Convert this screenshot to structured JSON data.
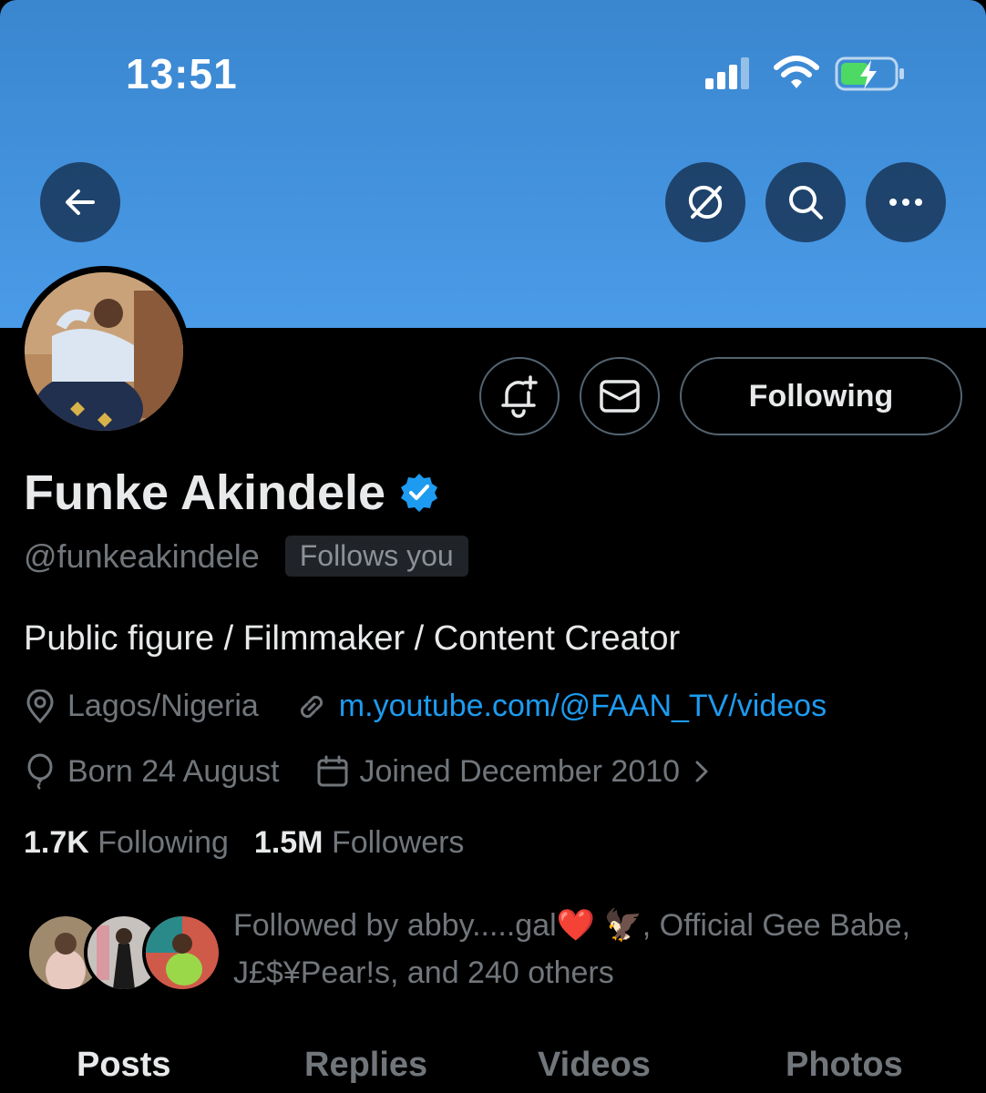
{
  "status_bar": {
    "time": "13:51"
  },
  "profile": {
    "display_name": "Funke Akindele",
    "handle": "@funkeakindele",
    "follows_you": "Follows you",
    "bio": "Public figure / Filmmaker / Content Creator",
    "location": "Lagos/Nigeria",
    "website": "m.youtube.com/@FAAN_TV/videos",
    "birthday": "Born 24 August",
    "joined": "Joined December 2010",
    "following_count": "1.7K",
    "following_label": "Following",
    "followers_count": "1.5M",
    "followers_label": "Followers"
  },
  "actions": {
    "following_button": "Following"
  },
  "followed_by": {
    "line1": "Followed by abby.....gal❤️ 🦅, Official Gee Babe,",
    "line2": "J£$¥Pear!s, and 240 others"
  },
  "tabs": [
    {
      "label": "Posts",
      "active": true
    },
    {
      "label": "Replies",
      "active": false
    },
    {
      "label": "Videos",
      "active": false
    },
    {
      "label": "Photos",
      "active": false
    }
  ],
  "colors": {
    "accent": "#1d9bf0",
    "banner": "#4a9be8",
    "verified": "#1d9bf0"
  },
  "icons": [
    "back-arrow-icon",
    "grok-icon",
    "search-icon",
    "more-icon",
    "notify-plus-icon",
    "mail-icon",
    "verified-badge-icon",
    "location-icon",
    "link-icon",
    "birthday-balloon-icon",
    "calendar-icon",
    "chevron-right-icon"
  ]
}
